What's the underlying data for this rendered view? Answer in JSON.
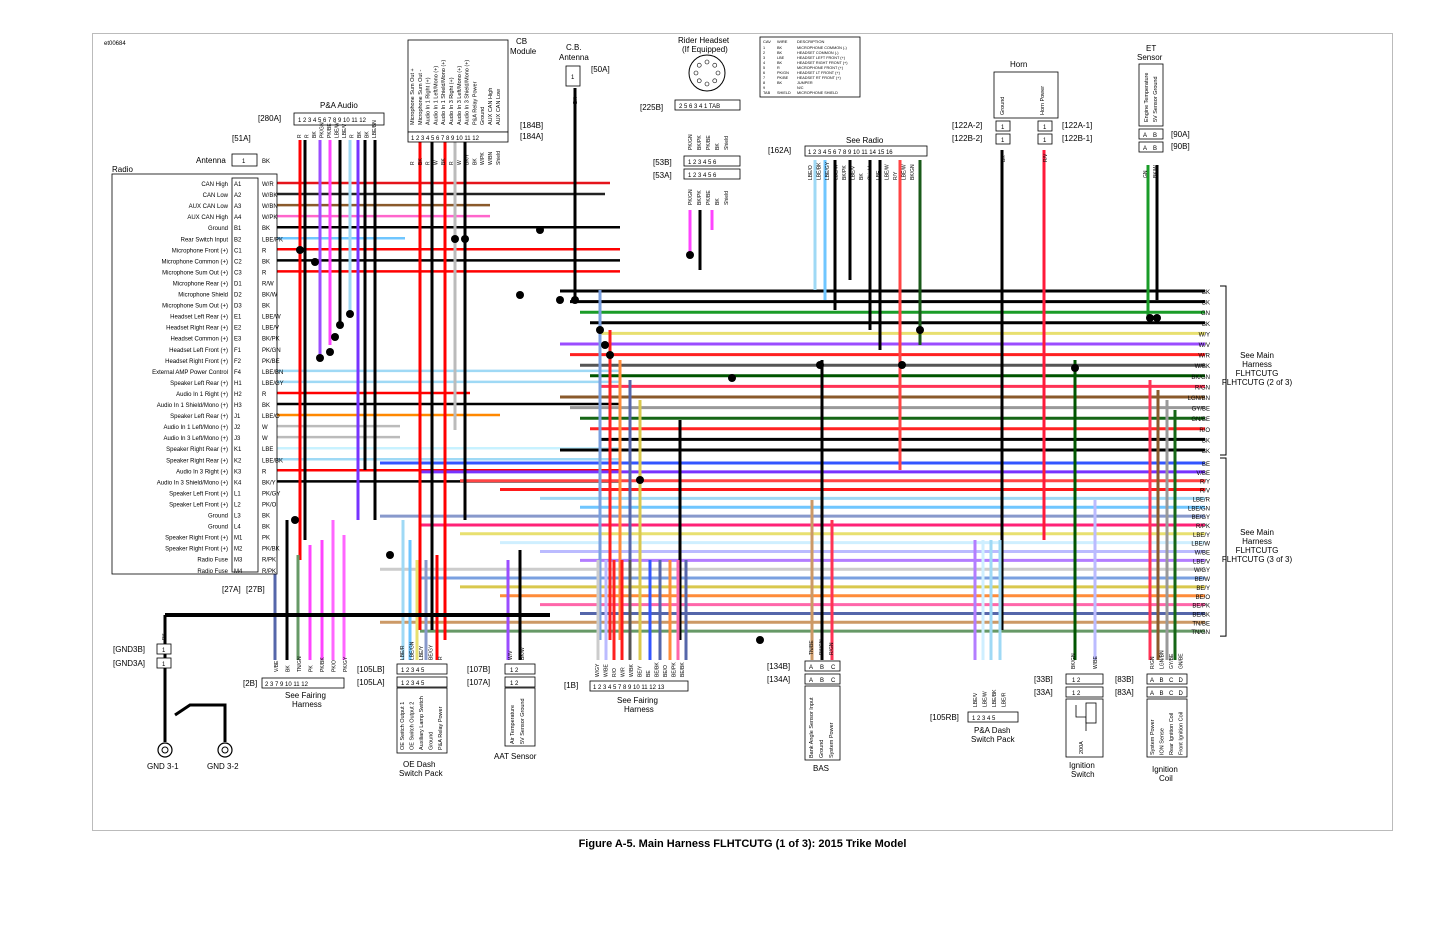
{
  "figure_id": "et00684",
  "caption": "Figure A-5. Main Harness FLHTCUTG (1 of 3): 2015 Trike Model",
  "radio": {
    "title": "Radio",
    "antenna_connector": "[51A]",
    "antenna_label": "Antenna",
    "pins": [
      {
        "name": "CAN High",
        "pin": "A1",
        "wire": "W/R",
        "color": "#e5141b"
      },
      {
        "name": "CAN Low",
        "pin": "A2",
        "wire": "W/BK",
        "color": "#222222"
      },
      {
        "name": "AUX CAN Low",
        "pin": "A3",
        "wire": "W/BN",
        "color": "#8a5a2b"
      },
      {
        "name": "AUX CAN High",
        "pin": "A4",
        "wire": "W/PK",
        "color": "#ff66cc"
      },
      {
        "name": "Ground",
        "pin": "B1",
        "wire": "BK",
        "color": "#000000"
      },
      {
        "name": "Rear Switch Input",
        "pin": "B2",
        "wire": "LBE/PK",
        "color": "#6fc6ff"
      },
      {
        "name": "Microphone Front (+)",
        "pin": "C1",
        "wire": "R",
        "color": "#ff0000"
      },
      {
        "name": "Microphone Common (+)",
        "pin": "C2",
        "wire": "BK",
        "color": "#000000"
      },
      {
        "name": "Microphone Sum Out (+)",
        "pin": "C3",
        "wire": "R",
        "color": "#ff0000"
      },
      {
        "name": "Microphone Rear (+)",
        "pin": "D1",
        "wire": "R/W",
        "color": "#ff0000"
      },
      {
        "name": "Microphone Shield",
        "pin": "D2",
        "wire": "BK/W",
        "color": "#000000"
      },
      {
        "name": "Microphone Sum Out (+)",
        "pin": "D3",
        "wire": "BK",
        "color": "#000000"
      },
      {
        "name": "Headset Left Rear (+)",
        "pin": "E1",
        "wire": "LBE/W",
        "color": "#9fd9f5"
      },
      {
        "name": "Headset Right Rear (+)",
        "pin": "E2",
        "wire": "LBE/V",
        "color": "#9fd9f5"
      },
      {
        "name": "Headset Common (+)",
        "pin": "E3",
        "wire": "BK/PK",
        "color": "#000000"
      },
      {
        "name": "Headset Left Front (+)",
        "pin": "F1",
        "wire": "PK/GN",
        "color": "#ff44ff"
      },
      {
        "name": "Headset Right Front (+)",
        "pin": "F2",
        "wire": "PK/BE",
        "color": "#ff44ff"
      },
      {
        "name": "External AMP Power Control",
        "pin": "F4",
        "wire": "LBE/BN",
        "color": "#9fd9f5"
      },
      {
        "name": "Speaker Left Rear (+)",
        "pin": "H1",
        "wire": "LBE/GY",
        "color": "#9fd9f5"
      },
      {
        "name": "Audio In 1 Right (+)",
        "pin": "H2",
        "wire": "R",
        "color": "#ff0000"
      },
      {
        "name": "Audio In 1 Shield/Mono (+)",
        "pin": "H3",
        "wire": "BK",
        "color": "#000000"
      },
      {
        "name": "Speaker Left Rear (+)",
        "pin": "J1",
        "wire": "LBE/O",
        "color": "#ff8800"
      },
      {
        "name": "Audio In 1 Left/Mono (+)",
        "pin": "J2",
        "wire": "W",
        "color": "#bbbbbb"
      },
      {
        "name": "Audio In 3 Left/Mono (+)",
        "pin": "J3",
        "wire": "W",
        "color": "#bbbbbb"
      },
      {
        "name": "Speaker Right Rear (+)",
        "pin": "K1",
        "wire": "LBE",
        "color": "#c8f2ff"
      },
      {
        "name": "Speaker Right Rear (+)",
        "pin": "K2",
        "wire": "LBE/BK",
        "color": "#9fd9f5"
      },
      {
        "name": "Audio In 3 Right (+)",
        "pin": "K3",
        "wire": "R",
        "color": "#ff0000"
      },
      {
        "name": "Audio In 3 Shield/Mono (+)",
        "pin": "K4",
        "wire": "BK/Y",
        "color": "#000000"
      },
      {
        "name": "Speaker Left Front (+)",
        "pin": "L1",
        "wire": "PK/GY",
        "color": "#ff66ff"
      },
      {
        "name": "Speaker Left Front (+)",
        "pin": "L2",
        "wire": "PK/O",
        "color": "#ff66ff"
      },
      {
        "name": "Ground",
        "pin": "L3",
        "wire": "BK",
        "color": "#000000"
      },
      {
        "name": "Ground",
        "pin": "L4",
        "wire": "BK",
        "color": "#000000"
      },
      {
        "name": "Speaker Right Front (+)",
        "pin": "M1",
        "wire": "PK",
        "color": "#ff55dd"
      },
      {
        "name": "Speaker Right Front (+)",
        "pin": "M2",
        "wire": "PK/BK",
        "color": "#ff55dd"
      },
      {
        "name": "Radio Fuse",
        "pin": "M3",
        "wire": "R/PK",
        "color": "#ff2277"
      },
      {
        "name": "Radio Fuse",
        "pin": "M4",
        "wire": "R/PK",
        "color": "#ff2277"
      }
    ],
    "bottom_connectors": [
      "[27A]",
      "[27B]"
    ]
  },
  "pa_audio": {
    "title": "P&A Audio",
    "connector": "[280A]",
    "pins": "1 2 3 4 5 6 7 8 9 10 11 12",
    "wires": [
      "R",
      "R",
      "BK",
      "PK/GN",
      "PK/BE",
      "LBE/W",
      "LBE/V",
      "R",
      "BK",
      "BK",
      "LBE/BN"
    ]
  },
  "cb_module": {
    "title": "CB Module",
    "connectors": [
      "[184B]",
      "[184A]"
    ],
    "functions": [
      "Microphone Sum Out +",
      "Microphone Sum Out -",
      "Audio In 1 Right (+)",
      "Audio In 1 Left/Mono (+)",
      "Audio In 1 Shield/Mono (+)",
      "Audio In 3 Right (+)",
      "Audio In 3 Left/Mono (+)",
      "Audio In 3 Shield/Mono (+)",
      "P&A Relay Power",
      "Ground",
      "AUX CAN High",
      "AUX CAN Low"
    ],
    "pins": "1 2 3 4 5 6 7 8 9 10 11 12",
    "wires": [
      "R",
      "BK",
      "R",
      "W",
      "BK",
      "R",
      "W",
      "BK/Y",
      "BK",
      "W/PK",
      "W/BN",
      "Shield"
    ]
  },
  "cb_antenna": {
    "title": "C.B. Antenna",
    "connector": "[50A]",
    "wire": "BK"
  },
  "rider_headset": {
    "title": "Rider Headset (If Equipped)",
    "connector_top": "[225B]",
    "connectors": [
      "[53B]",
      "[53A]"
    ],
    "pins": "1 2 3 4 5 6",
    "pins_top": "2 5 6 3 4 1 TAB",
    "wires": [
      "PK/GN",
      "BK/PK",
      "PK/BE",
      "BK",
      "Shield"
    ]
  },
  "pinout_table": {
    "headers": [
      "CAV",
      "WIRE",
      "DESCRIPTION"
    ],
    "rows": [
      [
        "1",
        "BK",
        "MICROPHONE COMMON (-)"
      ],
      [
        "2",
        "BK",
        "HEADSET COMMON (-)"
      ],
      [
        "3",
        "LBE",
        "HEADSET LEFT FRONT (+)"
      ],
      [
        "4",
        "BK",
        "HEADSET RIGHT FRONT (+)"
      ],
      [
        "5",
        "R",
        "MICROPHONE FRONT (+)"
      ],
      [
        "6",
        "PK/GN",
        "HEADSET LT FRONT (+)"
      ],
      [
        "7",
        "PK/BE",
        "HEADSET RT FRONT (+)"
      ],
      [
        "8",
        "BK",
        "JUMPER"
      ],
      [
        "9",
        "",
        "N/C"
      ],
      [
        "TAB",
        "SHIELD",
        "MICROPHONE SHIELD"
      ]
    ]
  },
  "see_radio": {
    "title": "See Radio",
    "connector": "[162A]",
    "pins": "1 2 3 4 5 6 7 8 9 10 11 14 15 16",
    "wires": [
      "LBE/O",
      "LBE/BK",
      "LBE/GY",
      "LBE/W",
      "BK/PK",
      "LBE/V",
      "BK",
      "Shield",
      "LBE",
      "LBE/W",
      "R/Y",
      "LBE/W",
      "BK/GN"
    ]
  },
  "horn": {
    "title": "Horn",
    "functions": [
      "Ground",
      "Horn Power"
    ],
    "connectors": [
      "[122A-2]",
      "[122B-2]",
      "[122A-1]",
      "[122B-1]"
    ],
    "wires": [
      "BK",
      "R/V"
    ]
  },
  "et_sensor": {
    "title": "ET Sensor",
    "functions": [
      "Engine Temperature",
      "5V Sensor Ground"
    ],
    "connectors": [
      "[90A]",
      "[90B]"
    ],
    "pins": [
      "A",
      "B"
    ],
    "wires": [
      "GN",
      "BK/W"
    ]
  },
  "main_harness_2": {
    "label": "See Main Harness FLHTCUTG (2 of 3)",
    "wires": [
      "BK",
      "BK",
      "GN",
      "BK",
      "W/Y",
      "W/V",
      "W/R",
      "W/BK",
      "BK/GN",
      "R/GN",
      "LGN/BN",
      "GY/BE",
      "GN/BE",
      "R/O",
      "BK",
      "BK"
    ]
  },
  "main_harness_3": {
    "label": "See Main Harness FLHTCUTG (3 of 3)",
    "wires": [
      "BE",
      "V/BE",
      "R/Y",
      "R/V",
      "LBE/R",
      "LBE/GN",
      "BE/GY",
      "R/PK",
      "LBE/Y",
      "LBE/W",
      "W/BE",
      "LBE/V",
      "W/GY",
      "BE/W",
      "BE/Y",
      "BE/O",
      "BE/PK",
      "BE/BK",
      "TN/BE",
      "TN/GN"
    ]
  },
  "gnd": {
    "connectors": [
      "[GND3B]",
      "[GND3A]"
    ],
    "labels": [
      "GND 3-1",
      "GND 3-2"
    ],
    "wire": "BK"
  },
  "see_fairing_left": {
    "title": "See Fairing Harness",
    "connector": "[2B]",
    "pins": "2 3 7 9 10 11 12",
    "wires": [
      "V/BE",
      "BK",
      "TN/GN",
      "PK",
      "PK/BK",
      "PK/O",
      "PK/GY"
    ]
  },
  "oe_dash": {
    "title": "OE Dash Switch Pack",
    "connectors": [
      "[105LB]",
      "[105LA]"
    ],
    "pins": "1 2 3 4 5",
    "functions": [
      "OE Switch Output 1",
      "OE Switch Output 2",
      "Auxiliary Lamp Switch",
      "Ground",
      "P&A Relay Power"
    ],
    "wires": [
      "LBE/R",
      "LBE/GN",
      "LBE/Y",
      "BE/GY",
      "R"
    ]
  },
  "aat_sensor": {
    "title": "AAT Sensor",
    "connectors": [
      "[107B]",
      "[107A]"
    ],
    "pins": "1 2",
    "functions": [
      "Air Temperature",
      "5V Sensor Ground"
    ],
    "wires": [
      "W/V",
      "BK/W"
    ]
  },
  "see_fairing_mid": {
    "title": "See Fairing Harness",
    "connector": "[1B]",
    "pins": "1 2 3 4 5 7 8 9 10 11 12 13",
    "wires": [
      "W/GY",
      "W/BE",
      "R/O",
      "W/R",
      "W/BK",
      "BE/Y",
      "BE",
      "BE/BK",
      "BE/O",
      "BE/PK",
      "BE/BK"
    ]
  },
  "bas": {
    "title": "BAS",
    "connectors": [
      "[134B]",
      "[134A]"
    ],
    "pins": [
      "A",
      "B",
      "C"
    ],
    "functions": [
      "Bank Angle Sensor Input",
      "Ground",
      "System Power"
    ],
    "wires": [
      "TN/BE",
      "BK/GN",
      "R/GN"
    ]
  },
  "pa_dash": {
    "title": "P&A Dash Switch Pack",
    "connector": "[105RB]",
    "pins": "1 2 3 4 5",
    "wires": [
      "LBE/V",
      "LBE/W",
      "LBE/BK",
      "LBE/R"
    ]
  },
  "ignition_switch": {
    "title": "Ignition Switch",
    "connectors": [
      "[33B]",
      "[33A]"
    ],
    "pins": "1 2",
    "wires": [
      "BK/GN",
      "W/BE"
    ],
    "part": "200A"
  },
  "ignition_coil": {
    "title": "Ignition Coil",
    "connectors": [
      "[83B]",
      "[83A]"
    ],
    "pins": [
      "A",
      "B",
      "C",
      "D"
    ],
    "functions": [
      "System Power",
      "ION Sense",
      "Rear Ignition Coil",
      "Front Ignition Coil"
    ],
    "wires": [
      "R/GN",
      "LGN/BN",
      "GY/BE",
      "GN/BE"
    ]
  }
}
